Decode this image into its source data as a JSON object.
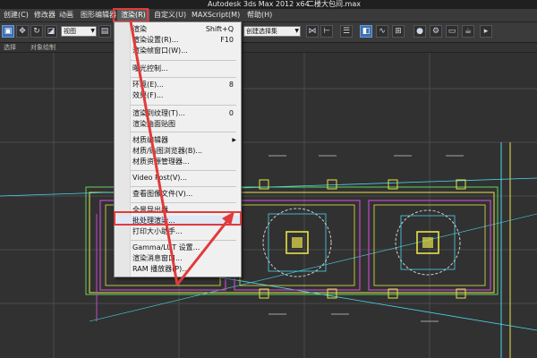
{
  "window": {
    "title": "Autodesk 3ds Max  2012 x64",
    "file": "二楼大包间.max"
  },
  "menubar": [
    "创建(C)",
    "修改器",
    "动画",
    "图形编辑器",
    "渲染(R)",
    "自定义(U)",
    "MAXScript(M)",
    "帮助(H)"
  ],
  "toolbar": {
    "view_combo": "视图",
    "selection_combo": "创建选择集",
    "shift_label": "Shift+Q"
  },
  "ribbon": {
    "left": "选择",
    "right": "对象绘制"
  },
  "render_menu": {
    "items": [
      {
        "label": "渲染",
        "shortcut": "Shift+Q"
      },
      {
        "label": "渲染设置(R)...",
        "shortcut": "F10"
      },
      {
        "label": "渲染帧窗口(W)...",
        "shortcut": ""
      },
      {
        "label": "曝光控制...",
        "shortcut": ""
      },
      {
        "label": "环境(E)...",
        "shortcut": "8"
      },
      {
        "label": "效果(F)...",
        "shortcut": ""
      },
      {
        "label": "渲染到纹理(T)...",
        "shortcut": "0"
      },
      {
        "label": "渲染曲面贴图",
        "shortcut": ""
      },
      {
        "label": "材质编辑器",
        "shortcut": ""
      },
      {
        "label": "材质/贴图浏览器(B)...",
        "shortcut": ""
      },
      {
        "label": "材质资源管理器...",
        "shortcut": ""
      },
      {
        "label": "Video Post(V)...",
        "shortcut": ""
      },
      {
        "label": "查看图像文件(V)...",
        "shortcut": ""
      },
      {
        "label": "全景导出器...",
        "shortcut": ""
      },
      {
        "label": "批处理渲染...",
        "shortcut": ""
      },
      {
        "label": "打印大小助手...",
        "shortcut": ""
      },
      {
        "label": "Gamma/LUT 设置...",
        "shortcut": ""
      },
      {
        "label": "渲染消息窗口...",
        "shortcut": ""
      },
      {
        "label": "RAM 播放器(P)...",
        "shortcut": ""
      }
    ]
  },
  "colors": {
    "highlight": "#e23b3b",
    "cad_yellow": "#e8e24a",
    "cad_magenta": "#c04ac8",
    "cad_cyan": "#4ad6e8",
    "cad_green": "#5fd35f"
  }
}
